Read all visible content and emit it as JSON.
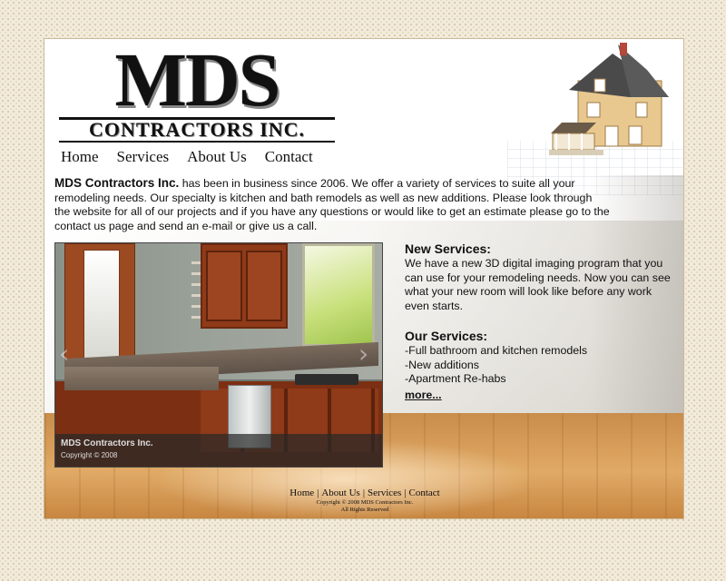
{
  "logo": {
    "mds": "MDS",
    "subtitle": "CONTRACTORS INC."
  },
  "nav": [
    {
      "label": "Home"
    },
    {
      "label": "Services"
    },
    {
      "label": "About Us"
    },
    {
      "label": "Contact"
    }
  ],
  "intro": {
    "company": "MDS Contractors Inc.",
    "text": " has been in business since 2006. We offer a variety of services to suite all your remodeling needs. Our specialty is kitchen and bath remodels as well as new additions. Please look through the website for all of our projects and if you have any questions or would like to get an estimate please go to the contact us page and send an e-mail or give us a call."
  },
  "slideshow": {
    "caption_title": "MDS Contractors Inc.",
    "caption_sub": "Copyright © 2008",
    "prev_icon": "chevron-left-icon",
    "next_icon": "chevron-right-icon"
  },
  "new_services": {
    "heading": "New Services:",
    "text": "We have a new 3D digital imaging program that you can use for your remodeling needs. Now you can see what your new room will look like before any work even starts."
  },
  "our_services": {
    "heading": "Our Services:",
    "items": [
      "-Full bathroom and kitchen remodels",
      "-New additions",
      "-Apartment Re-habs"
    ],
    "more": "more..."
  },
  "footer": {
    "links": [
      "Home",
      "About Us",
      "Services",
      "Contact"
    ],
    "separator": "|",
    "copyright": "Copyright © 2008 MDS Contractors Inc.",
    "rights": "All Rights Reserved"
  },
  "colors": {
    "background": "#f3ecdc",
    "border": "#c9b997",
    "text": "#111111",
    "floor": "#d69c58",
    "cabinet": "#8f3a18"
  }
}
